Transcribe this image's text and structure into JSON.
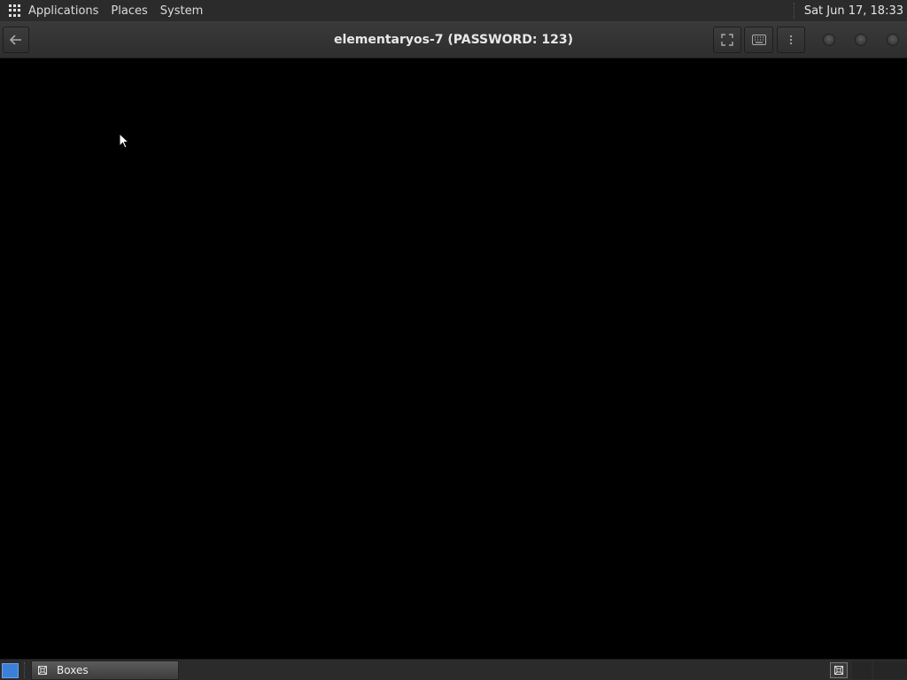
{
  "top_panel": {
    "menus": [
      "Applications",
      "Places",
      "System"
    ],
    "clock": "Sat Jun 17, 18:33"
  },
  "header": {
    "title": "elementaryos-7 (PASSWORD: 123)",
    "icons": {
      "back": "back-arrow-icon",
      "fullscreen": "fullscreen-icon",
      "keyboard": "keyboard-icon",
      "menu": "kebab-menu-icon"
    }
  },
  "taskbar": {
    "tasks": [
      {
        "label": "Boxes",
        "icon": "boxes-icon",
        "active": true
      }
    ]
  },
  "colors": {
    "panel": "#2b2b2b",
    "header": "#333333",
    "vm_background": "#000000",
    "show_desktop": "#3b7fd8"
  }
}
